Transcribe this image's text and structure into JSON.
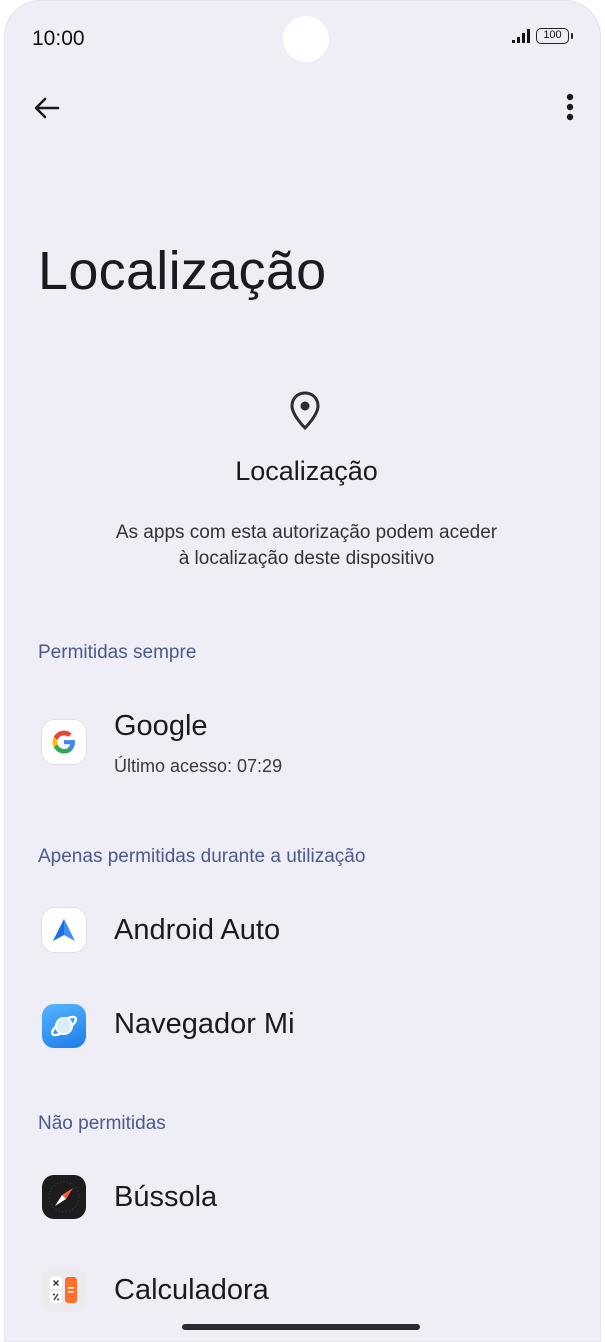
{
  "status_bar": {
    "time": "10:00",
    "battery": "100"
  },
  "page": {
    "title": "Localização"
  },
  "header": {
    "title": "Localização",
    "description_line1": "As apps com esta autorização podem aceder",
    "description_line2": "à localização deste dispositivo"
  },
  "sections": {
    "always": {
      "label": "Permitidas sempre",
      "apps": [
        {
          "name": "Google",
          "subtitle": "Último acesso: 07:29",
          "icon": "google-icon"
        }
      ]
    },
    "while_using": {
      "label": "Apenas permitidas durante a utilização",
      "apps": [
        {
          "name": "Android Auto",
          "icon": "android-auto-icon"
        },
        {
          "name": "Navegador Mi",
          "icon": "mi-browser-icon"
        }
      ]
    },
    "denied": {
      "label": "Não permitidas",
      "apps": [
        {
          "name": "Bússola",
          "icon": "compass-icon"
        },
        {
          "name": "Calculadora",
          "icon": "calculator-icon"
        }
      ]
    }
  },
  "colors": {
    "background": "#efedf6",
    "section_label": "#4a5a8c",
    "accent_blue": "#3a8ef0"
  }
}
